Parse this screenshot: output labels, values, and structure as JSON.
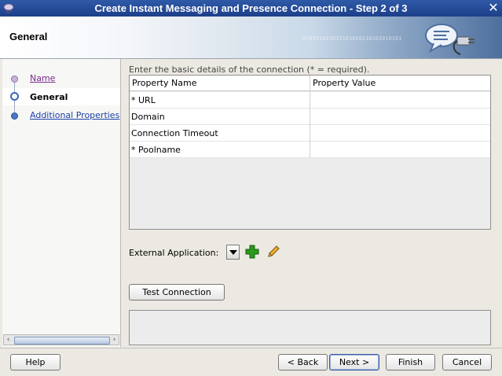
{
  "window": {
    "title": "Create Instant Messaging and Presence Connection - Step 2 of 3"
  },
  "header": {
    "title": "General",
    "binary_text": "010101001010101010110101010101"
  },
  "nav": {
    "steps": [
      {
        "label": "Name",
        "state": "visited"
      },
      {
        "label": "General",
        "state": "current"
      },
      {
        "label": "Additional Properties",
        "state": "link"
      }
    ]
  },
  "content": {
    "hint": "Enter the basic details of the connection (* = required).",
    "table": {
      "columns": [
        "Property Name",
        "Property Value"
      ],
      "rows": [
        {
          "name": "* URL",
          "value": ""
        },
        {
          "name": "Domain",
          "value": ""
        },
        {
          "name": "Connection Timeout",
          "value": ""
        },
        {
          "name": "* Poolname",
          "value": ""
        }
      ]
    },
    "external_application_label": "External Application:",
    "test_connection_label": "Test Connection"
  },
  "buttons": {
    "help": "Help",
    "back": "< Back",
    "next": "Next >",
    "finish": "Finish",
    "cancel": "Cancel"
  },
  "icons": {
    "close": "close-icon",
    "add": "add-icon",
    "edit": "edit-pencil-icon",
    "dropdown": "dropdown-arrow-icon",
    "header": "chat-bubble-plug-icon"
  },
  "colors": {
    "title_bar": "#2f5aa8",
    "link": "#1c3fa8",
    "visited": "#7a2a8a",
    "add_icon": "#2a9a1a"
  }
}
